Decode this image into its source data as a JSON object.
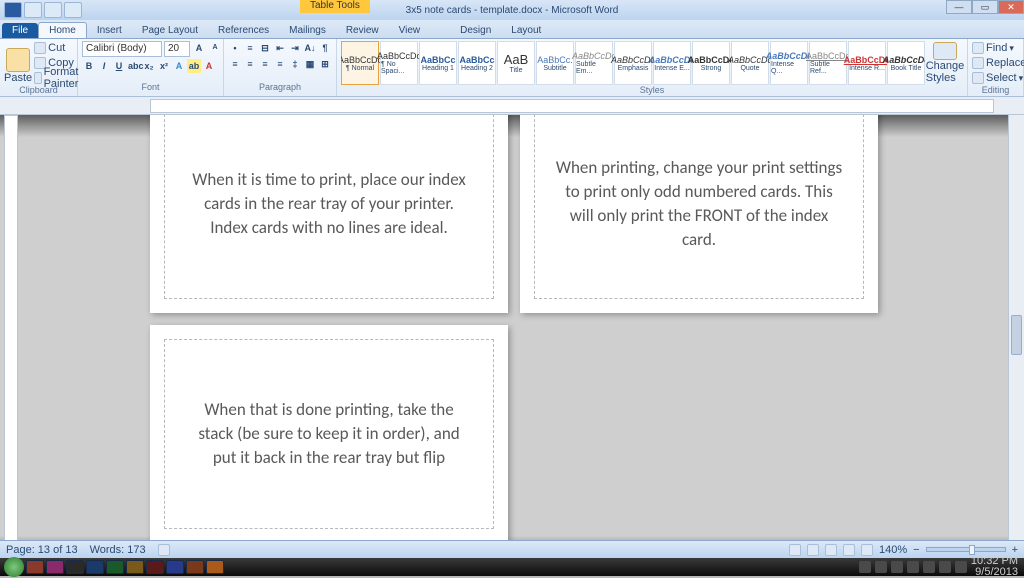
{
  "title_context": "Table Tools",
  "doc_title": "3x5 note cards - template.docx - Microsoft Word",
  "tabs": [
    "File",
    "Home",
    "Insert",
    "Page Layout",
    "References",
    "Mailings",
    "Review",
    "View"
  ],
  "ctx_tabs": [
    "Design",
    "Layout"
  ],
  "clipboard": {
    "paste": "Paste",
    "cut": "Cut",
    "copy": "Copy",
    "fp": "Format Painter",
    "label": "Clipboard"
  },
  "font": {
    "name": "Calibri (Body)",
    "size": "20",
    "label": "Font"
  },
  "paragraph": {
    "label": "Paragraph"
  },
  "styles": {
    "label": "Styles",
    "items": [
      {
        "prev": "AaBbCcDc",
        "name": "¶ Normal"
      },
      {
        "prev": "AaBbCcDc",
        "name": "¶ No Spaci..."
      },
      {
        "prev": "AaBbCc",
        "name": "Heading 1"
      },
      {
        "prev": "AaBbCc",
        "name": "Heading 2"
      },
      {
        "prev": "AaB",
        "name": "Title"
      },
      {
        "prev": "AaBbCc.",
        "name": "Subtitle"
      },
      {
        "prev": "AaBbCcDc",
        "name": "Subtle Em..."
      },
      {
        "prev": "AaBbCcDc",
        "name": "Emphasis"
      },
      {
        "prev": "AaBbCcDc",
        "name": "Intense E..."
      },
      {
        "prev": "AaBbCcDc",
        "name": "Strong"
      },
      {
        "prev": "AaBbCcDc",
        "name": "Quote"
      },
      {
        "prev": "AaBbCcDc",
        "name": "Intense Q..."
      },
      {
        "prev": "AaBbCcDc",
        "name": "Subtle Ref..."
      },
      {
        "prev": "AaBbCcDc",
        "name": "Intense R..."
      },
      {
        "prev": "AaBbCcDc",
        "name": "Book Title"
      }
    ],
    "change": "Change Styles"
  },
  "editing": {
    "find": "Find",
    "replace": "Replace",
    "select": "Select",
    "label": "Editing"
  },
  "cards": [
    "When it is time to print, place our index cards in the rear tray of your printer.  Index cards with no lines are ideal.",
    "When printing, change your print settings to print only odd numbered cards.  This will only print the FRONT of the index card.",
    "When that is done printing, take the stack (be sure to keep it in order), and put it back in the rear tray but flip"
  ],
  "status": {
    "page": "Page: 13 of 13",
    "words": "Words: 173",
    "zoom": "140%"
  },
  "tray": {
    "time": "10:32 PM",
    "date": "9/5/2013"
  }
}
